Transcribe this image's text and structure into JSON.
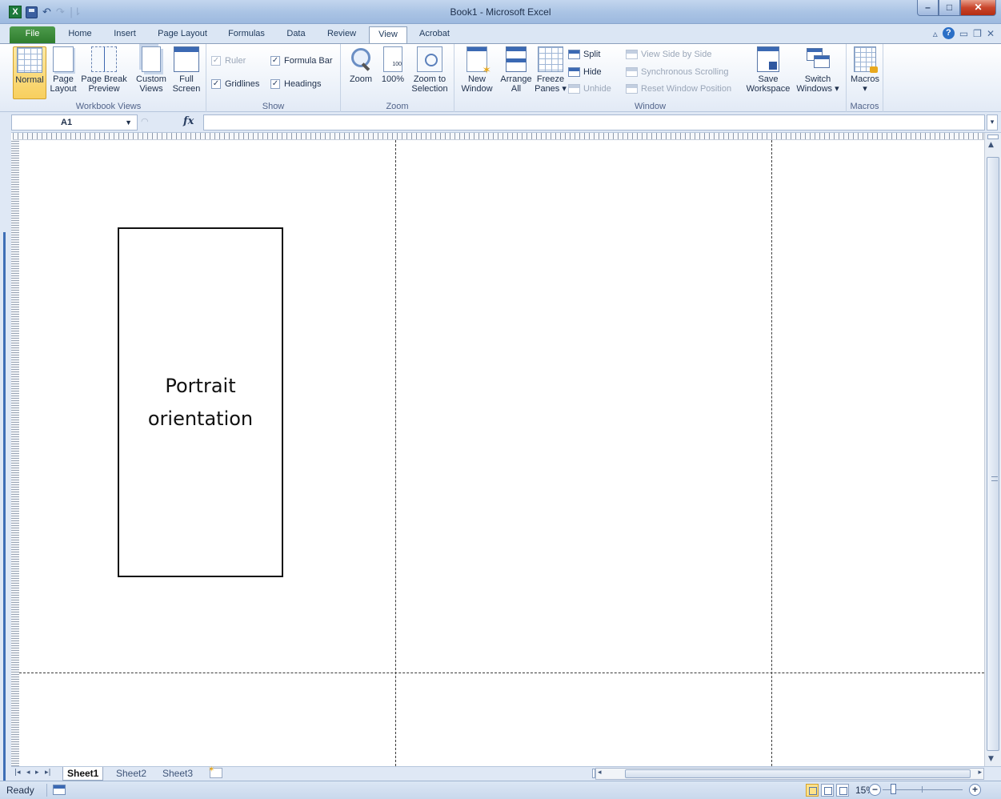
{
  "window": {
    "title": "Book1  -  Microsoft Excel",
    "app_icon": "X",
    "controls": {
      "minimize": "–",
      "maximize": "□",
      "close": "✕"
    }
  },
  "qat": {
    "undo": "↶",
    "redo": "↷",
    "customize": "|⇂"
  },
  "tabs": [
    {
      "label": "File"
    },
    {
      "label": "Home"
    },
    {
      "label": "Insert"
    },
    {
      "label": "Page Layout"
    },
    {
      "label": "Formulas"
    },
    {
      "label": "Data"
    },
    {
      "label": "Review"
    },
    {
      "label": "View",
      "active": true
    },
    {
      "label": "Acrobat"
    }
  ],
  "ribbon": {
    "workbook_views": {
      "label": "Workbook Views",
      "normal": "Normal",
      "page_layout": [
        "Page",
        "Layout"
      ],
      "page_break": [
        "Page Break",
        "Preview"
      ],
      "custom_views": [
        "Custom",
        "Views"
      ],
      "full_screen": [
        "Full",
        "Screen"
      ]
    },
    "show": {
      "label": "Show",
      "ruler": {
        "label": "Ruler",
        "checked": true,
        "enabled": false
      },
      "formula_bar": {
        "label": "Formula Bar",
        "checked": true
      },
      "gridlines": {
        "label": "Gridlines",
        "checked": true
      },
      "headings": {
        "label": "Headings",
        "checked": true
      }
    },
    "zoom": {
      "label": "Zoom",
      "zoom": "Zoom",
      "hundred": "100%",
      "hundred_icon_text": "100",
      "zoom_selection": [
        "Zoom to",
        "Selection"
      ]
    },
    "window": {
      "label": "Window",
      "new_window": [
        "New",
        "Window"
      ],
      "arrange_all": [
        "Arrange",
        "All"
      ],
      "freeze_panes": [
        "Freeze",
        "Panes ▾"
      ],
      "split": "Split",
      "hide": "Hide",
      "unhide": "Unhide",
      "view_side_by_side": "View Side by Side",
      "sync_scrolling": "Synchronous Scrolling",
      "reset_position": "Reset Window Position",
      "save_workspace": [
        "Save",
        "Workspace"
      ],
      "switch_windows": [
        "Switch",
        "Windows ▾"
      ]
    },
    "macros": {
      "label": "Macros",
      "button": "Macros",
      "arrow": "▾"
    }
  },
  "formula_bar": {
    "name_box": "A1",
    "fx": "fx",
    "value": ""
  },
  "sheet": {
    "box_text": "Portrait orientation"
  },
  "sheet_tabs": [
    {
      "label": "Sheet1",
      "active": true
    },
    {
      "label": "Sheet2"
    },
    {
      "label": "Sheet3"
    }
  ],
  "nav_arrows": [
    "|◂",
    "◂",
    "▸",
    "▸|"
  ],
  "status": {
    "ready": "Ready",
    "zoom": "15%"
  }
}
